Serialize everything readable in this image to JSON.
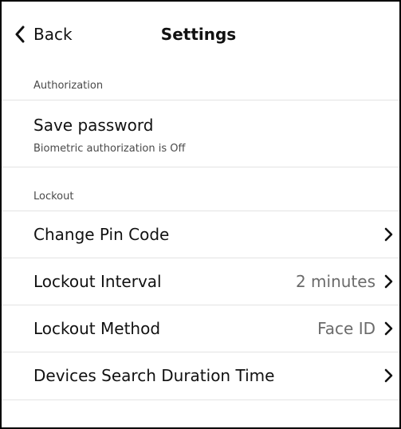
{
  "header": {
    "back_label": "Back",
    "title": "Settings"
  },
  "sections": {
    "authorization": {
      "header": "Authorization",
      "save_password": {
        "title": "Save password",
        "subtitle": "Biometric authorization is Off"
      }
    },
    "lockout": {
      "header": "Lockout",
      "items": [
        {
          "label": "Change Pin Code",
          "value": ""
        },
        {
          "label": "Lockout Interval",
          "value": "2 minutes"
        },
        {
          "label": "Lockout Method",
          "value": "Face ID"
        },
        {
          "label": "Devices Search Duration Time",
          "value": ""
        }
      ]
    }
  },
  "icons": {
    "back": "chevron-left-icon",
    "disclosure": "chevron-right-icon"
  },
  "colors": {
    "text_primary": "#111111",
    "text_secondary": "#4a4a4a",
    "value_text": "#6b6b6b",
    "divider": "#e3e3e3",
    "frame_border": "#000000"
  }
}
